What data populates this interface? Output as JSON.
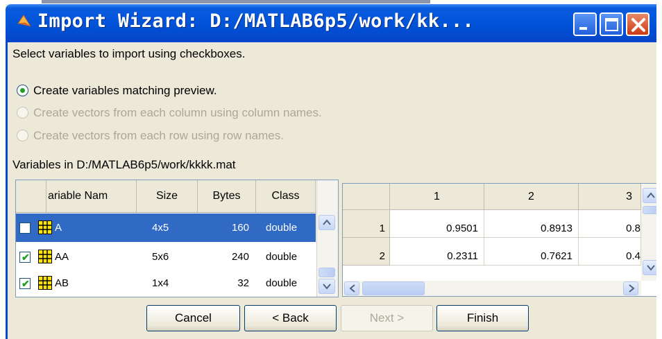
{
  "window": {
    "title": "Import Wizard: D:/MATLAB6p5/work/kk...",
    "title_color": "#0054e3",
    "controls": [
      "minimize-icon",
      "maximize-icon",
      "close-icon"
    ]
  },
  "instructions": "Select variables to import using checkboxes.",
  "options": [
    {
      "label": "Create variables matching preview.",
      "selected": true,
      "enabled": true
    },
    {
      "label": "Create vectors from each column using column names.",
      "selected": false,
      "enabled": false
    },
    {
      "label": "Create vectors from each row using row names.",
      "selected": false,
      "enabled": false
    }
  ],
  "variables_label": "Variables in D:/MATLAB6p5/work/kkkk.mat",
  "variables_table": {
    "columns": [
      "ariable Nam",
      "Size",
      "Bytes",
      "Class"
    ],
    "rows": [
      {
        "checked": false,
        "name": "A",
        "size": "4x5",
        "bytes": "160",
        "class": "double",
        "selected": true
      },
      {
        "checked": true,
        "name": "AA",
        "size": "5x6",
        "bytes": "240",
        "class": "double",
        "selected": false
      },
      {
        "checked": true,
        "name": "AB",
        "size": "1x4",
        "bytes": "32",
        "class": "double",
        "selected": false
      }
    ]
  },
  "preview": {
    "col_headers": [
      "1",
      "2",
      "3"
    ],
    "rows": [
      {
        "header": "1",
        "cells": [
          "0.9501",
          "0.8913",
          "0.8"
        ]
      },
      {
        "header": "2",
        "cells": [
          "0.2311",
          "0.7621",
          "0.4"
        ]
      }
    ]
  },
  "buttons": {
    "cancel": "Cancel",
    "back": "< Back",
    "next": "Next >",
    "finish": "Finish"
  },
  "colors": {
    "selection": "#316ac5",
    "check": "#21a121",
    "dialog_bg": "#ece9d8"
  }
}
